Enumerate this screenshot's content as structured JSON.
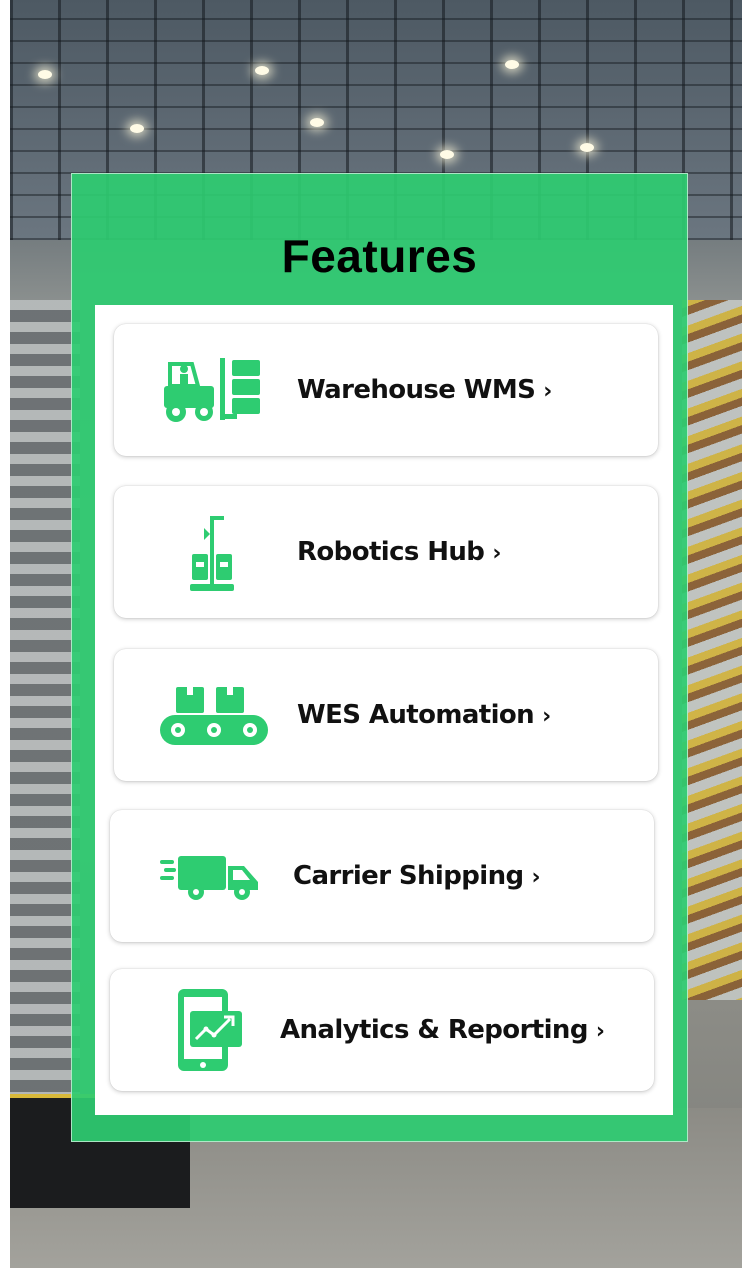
{
  "panel": {
    "title": "Features",
    "accent_color": "#2ecc71"
  },
  "features": [
    {
      "label": "Warehouse WMS",
      "chevron": "›",
      "icon": "forklift-icon"
    },
    {
      "label": "Robotics Hub",
      "chevron": "›",
      "icon": "robot-arm-icon"
    },
    {
      "label": "WES Automation",
      "chevron": "›",
      "icon": "conveyor-icon"
    },
    {
      "label": "Carrier Shipping",
      "chevron": "›",
      "icon": "delivery-truck-icon"
    },
    {
      "label": "Analytics & Reporting",
      "chevron": "›",
      "icon": "analytics-phone-icon"
    }
  ]
}
